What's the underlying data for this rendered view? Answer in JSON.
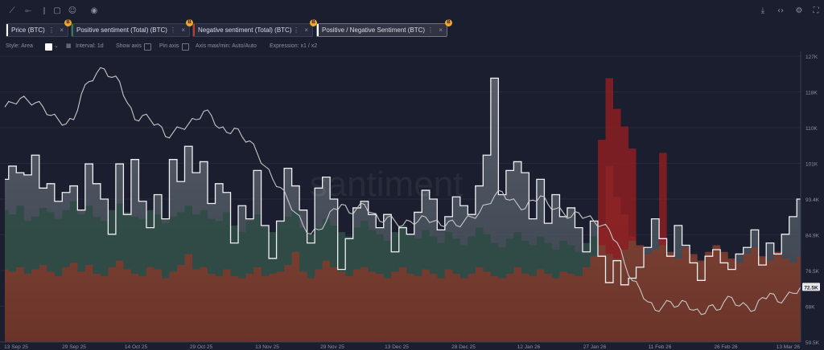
{
  "toolbar": {
    "left_icons": [
      "line-tool-icon",
      "horizontal-line-icon",
      "vertical-line-icon",
      "note-icon",
      "emoji-icon",
      "eye-icon"
    ],
    "right_icons": [
      "download-icon",
      "embed-icon",
      "settings-icon",
      "fullscreen-icon"
    ]
  },
  "tabs": [
    {
      "label": "Price (BTC)",
      "color": "#ffffff",
      "badge": ""
    },
    {
      "label": "Positive sentiment (Total) (BTC)",
      "color": "#2e7d4f",
      "badge": "B"
    },
    {
      "label": "Negative sentiment (Total) (BTC)",
      "color": "#c0392b",
      "badge": "B"
    },
    {
      "label": "Positive / Negative Sentiment (BTC)",
      "color": "#ffffff",
      "badge": "B"
    }
  ],
  "settings": {
    "style": "Style: Area",
    "interval": "Interval: 1d",
    "show_axis": "Show axis",
    "pin_axis": "Pin axis",
    "axis_max_min": "Axis max/min: Auto/Auto",
    "expression": "Expression: x1 / x2"
  },
  "watermark": "santiment",
  "chart_data": {
    "type": "area",
    "x_labels": [
      "13 Sep 25",
      "29 Sep 25",
      "14 Oct 25",
      "29 Oct 25",
      "13 Nov 25",
      "29 Nov 25",
      "13 Dec 25",
      "28 Dec 25",
      "12 Jan 26",
      "27 Jan 26",
      "11 Feb 26",
      "26 Feb 26",
      "13 Mar 26"
    ],
    "y_ticks": [
      "127K",
      "118K",
      "110K",
      "101K",
      "93.4K",
      "84.9K",
      "76.5K",
      "68K",
      "59.5K"
    ],
    "ylim": [
      59.5,
      127
    ],
    "current_price_label": "72.5K",
    "colors": {
      "price": "#c8c8c8",
      "positive": "#2e5a4a",
      "negative": "#8a2b2b",
      "ratio": "#ffffff",
      "lower_fill": "#7a3b30",
      "upper_fill": "#555866"
    },
    "series": [
      {
        "name": "Price (BTC)",
        "values": [
          115,
          116,
          117,
          116.5,
          116,
          115,
          113,
          112,
          111,
          112,
          118,
          121,
          123,
          124,
          122,
          121,
          116,
          112,
          113,
          112,
          111,
          108,
          109,
          110,
          111,
          112,
          114,
          113,
          110,
          109,
          110,
          108,
          107,
          104,
          101,
          98,
          96,
          93,
          90,
          87,
          85,
          86,
          88,
          91,
          92,
          90,
          91,
          92,
          90,
          88,
          89,
          88,
          87,
          88,
          88,
          89,
          88,
          87,
          88,
          87,
          88,
          89,
          90,
          92,
          94,
          95,
          93,
          92,
          91,
          93,
          94,
          92,
          91,
          90,
          89,
          90,
          89,
          88,
          87,
          86,
          83,
          78,
          74,
          72,
          69,
          67,
          68,
          69,
          68,
          69,
          67,
          66,
          68,
          67,
          69,
          70,
          68,
          68,
          67,
          70,
          71,
          69,
          70,
          71,
          72.5
        ]
      },
      {
        "name": "Positive sentiment (Total) (BTC)",
        "values": [
          60,
          58,
          62,
          55,
          57,
          61,
          59,
          56,
          60,
          64,
          58,
          62,
          57,
          55,
          60,
          63,
          59,
          57,
          56,
          60,
          58,
          54,
          57,
          59,
          62,
          58,
          60,
          56,
          55,
          59,
          53,
          50,
          55,
          58,
          52,
          50,
          54,
          57,
          60,
          52,
          49,
          52,
          56,
          53,
          50,
          48,
          52,
          55,
          51,
          49,
          46,
          50,
          53,
          49,
          47,
          51,
          48,
          45,
          50,
          47,
          44,
          48,
          52,
          49,
          45,
          43,
          47,
          50,
          46,
          44,
          48,
          45,
          42,
          46,
          44,
          41,
          45,
          48,
          44,
          40,
          38,
          42,
          46,
          43,
          39,
          41,
          44,
          40,
          38,
          42,
          39,
          36,
          40,
          43,
          40,
          37,
          35,
          39,
          42,
          38,
          36,
          40,
          37,
          35,
          38
        ]
      },
      {
        "name": "Negative sentiment (Total) (BTC)",
        "values": [
          33,
          32,
          34,
          31,
          33,
          35,
          32,
          30,
          34,
          36,
          32,
          35,
          31,
          30,
          34,
          37,
          33,
          31,
          30,
          34,
          33,
          29,
          32,
          35,
          40,
          33,
          34,
          31,
          30,
          33,
          30,
          29,
          31,
          34,
          30,
          31,
          32,
          35,
          41,
          32,
          29,
          33,
          37,
          34,
          32,
          30,
          33,
          34,
          32,
          31,
          29,
          32,
          34,
          31,
          30,
          33,
          31,
          29,
          33,
          31,
          29,
          31,
          34,
          32,
          30,
          29,
          31,
          34,
          31,
          30,
          33,
          31,
          29,
          32,
          31,
          30,
          34,
          39,
          52,
          80,
          66,
          58,
          48,
          44,
          40,
          42,
          46,
          41,
          38,
          43,
          40,
          37,
          41,
          44,
          41,
          38,
          36,
          40,
          43,
          39,
          37,
          41,
          38,
          36,
          39
        ]
      },
      {
        "name": "Positive / Negative Sentiment (BTC)",
        "values": [
          74,
          80,
          77,
          76,
          85,
          70,
          72,
          64,
          68,
          71,
          60,
          81,
          72,
          65,
          49,
          81,
          58,
          83,
          64,
          52,
          67,
          56,
          83,
          73,
          89,
          77,
          82,
          63,
          72,
          68,
          45,
          62,
          56,
          78,
          53,
          38,
          55,
          79,
          71,
          60,
          45,
          70,
          75,
          65,
          33,
          47,
          61,
          64,
          58,
          52,
          58,
          41,
          52,
          49,
          59,
          69,
          65,
          51,
          57,
          66,
          62,
          58,
          71,
          85,
          120,
          67,
          78,
          82,
          77,
          56,
          74,
          54,
          67,
          57,
          61,
          52,
          41,
          55,
          39,
          27,
          37,
          26,
          29,
          34,
          43,
          56,
          47,
          39,
          53,
          44,
          36,
          28,
          39,
          42,
          36,
          33,
          40,
          43,
          51,
          35,
          45,
          40,
          49,
          57,
          65
        ]
      }
    ]
  }
}
